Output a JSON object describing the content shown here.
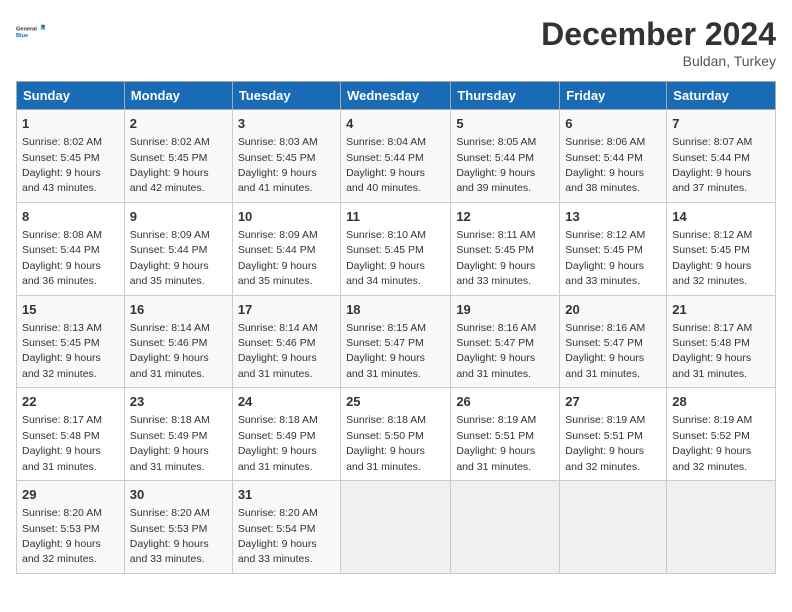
{
  "logo": {
    "line1": "General",
    "line2": "Blue"
  },
  "title": "December 2024",
  "subtitle": "Buldan, Turkey",
  "days_of_week": [
    "Sunday",
    "Monday",
    "Tuesday",
    "Wednesday",
    "Thursday",
    "Friday",
    "Saturday"
  ],
  "weeks": [
    [
      {
        "day": 1,
        "info": "Sunrise: 8:02 AM\nSunset: 5:45 PM\nDaylight: 9 hours\nand 43 minutes."
      },
      {
        "day": 2,
        "info": "Sunrise: 8:02 AM\nSunset: 5:45 PM\nDaylight: 9 hours\nand 42 minutes."
      },
      {
        "day": 3,
        "info": "Sunrise: 8:03 AM\nSunset: 5:45 PM\nDaylight: 9 hours\nand 41 minutes."
      },
      {
        "day": 4,
        "info": "Sunrise: 8:04 AM\nSunset: 5:44 PM\nDaylight: 9 hours\nand 40 minutes."
      },
      {
        "day": 5,
        "info": "Sunrise: 8:05 AM\nSunset: 5:44 PM\nDaylight: 9 hours\nand 39 minutes."
      },
      {
        "day": 6,
        "info": "Sunrise: 8:06 AM\nSunset: 5:44 PM\nDaylight: 9 hours\nand 38 minutes."
      },
      {
        "day": 7,
        "info": "Sunrise: 8:07 AM\nSunset: 5:44 PM\nDaylight: 9 hours\nand 37 minutes."
      }
    ],
    [
      {
        "day": 8,
        "info": "Sunrise: 8:08 AM\nSunset: 5:44 PM\nDaylight: 9 hours\nand 36 minutes."
      },
      {
        "day": 9,
        "info": "Sunrise: 8:09 AM\nSunset: 5:44 PM\nDaylight: 9 hours\nand 35 minutes."
      },
      {
        "day": 10,
        "info": "Sunrise: 8:09 AM\nSunset: 5:44 PM\nDaylight: 9 hours\nand 35 minutes."
      },
      {
        "day": 11,
        "info": "Sunrise: 8:10 AM\nSunset: 5:45 PM\nDaylight: 9 hours\nand 34 minutes."
      },
      {
        "day": 12,
        "info": "Sunrise: 8:11 AM\nSunset: 5:45 PM\nDaylight: 9 hours\nand 33 minutes."
      },
      {
        "day": 13,
        "info": "Sunrise: 8:12 AM\nSunset: 5:45 PM\nDaylight: 9 hours\nand 33 minutes."
      },
      {
        "day": 14,
        "info": "Sunrise: 8:12 AM\nSunset: 5:45 PM\nDaylight: 9 hours\nand 32 minutes."
      }
    ],
    [
      {
        "day": 15,
        "info": "Sunrise: 8:13 AM\nSunset: 5:45 PM\nDaylight: 9 hours\nand 32 minutes."
      },
      {
        "day": 16,
        "info": "Sunrise: 8:14 AM\nSunset: 5:46 PM\nDaylight: 9 hours\nand 31 minutes."
      },
      {
        "day": 17,
        "info": "Sunrise: 8:14 AM\nSunset: 5:46 PM\nDaylight: 9 hours\nand 31 minutes."
      },
      {
        "day": 18,
        "info": "Sunrise: 8:15 AM\nSunset: 5:47 PM\nDaylight: 9 hours\nand 31 minutes."
      },
      {
        "day": 19,
        "info": "Sunrise: 8:16 AM\nSunset: 5:47 PM\nDaylight: 9 hours\nand 31 minutes."
      },
      {
        "day": 20,
        "info": "Sunrise: 8:16 AM\nSunset: 5:47 PM\nDaylight: 9 hours\nand 31 minutes."
      },
      {
        "day": 21,
        "info": "Sunrise: 8:17 AM\nSunset: 5:48 PM\nDaylight: 9 hours\nand 31 minutes."
      }
    ],
    [
      {
        "day": 22,
        "info": "Sunrise: 8:17 AM\nSunset: 5:48 PM\nDaylight: 9 hours\nand 31 minutes."
      },
      {
        "day": 23,
        "info": "Sunrise: 8:18 AM\nSunset: 5:49 PM\nDaylight: 9 hours\nand 31 minutes."
      },
      {
        "day": 24,
        "info": "Sunrise: 8:18 AM\nSunset: 5:49 PM\nDaylight: 9 hours\nand 31 minutes."
      },
      {
        "day": 25,
        "info": "Sunrise: 8:18 AM\nSunset: 5:50 PM\nDaylight: 9 hours\nand 31 minutes."
      },
      {
        "day": 26,
        "info": "Sunrise: 8:19 AM\nSunset: 5:51 PM\nDaylight: 9 hours\nand 31 minutes."
      },
      {
        "day": 27,
        "info": "Sunrise: 8:19 AM\nSunset: 5:51 PM\nDaylight: 9 hours\nand 32 minutes."
      },
      {
        "day": 28,
        "info": "Sunrise: 8:19 AM\nSunset: 5:52 PM\nDaylight: 9 hours\nand 32 minutes."
      }
    ],
    [
      {
        "day": 29,
        "info": "Sunrise: 8:20 AM\nSunset: 5:53 PM\nDaylight: 9 hours\nand 32 minutes."
      },
      {
        "day": 30,
        "info": "Sunrise: 8:20 AM\nSunset: 5:53 PM\nDaylight: 9 hours\nand 33 minutes."
      },
      {
        "day": 31,
        "info": "Sunrise: 8:20 AM\nSunset: 5:54 PM\nDaylight: 9 hours\nand 33 minutes."
      },
      null,
      null,
      null,
      null
    ]
  ],
  "accent_color": "#1a6bb5"
}
